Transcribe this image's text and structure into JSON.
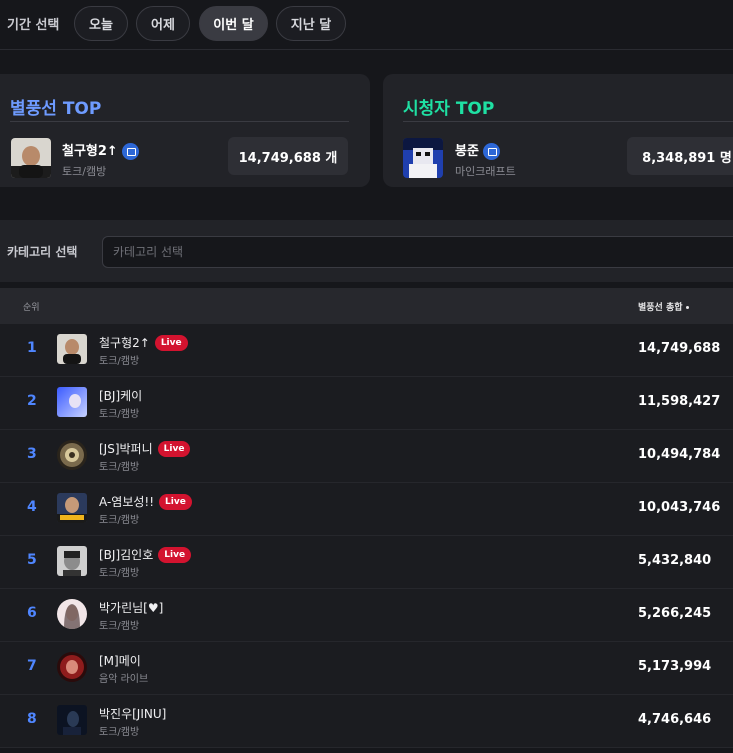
{
  "period": {
    "label": "기간 선택",
    "options": [
      {
        "label": "오늘"
      },
      {
        "label": "어제"
      },
      {
        "label": "이번 달",
        "active": true
      },
      {
        "label": "지난 달"
      }
    ]
  },
  "balloon_top": {
    "title": "별풍선 TOP",
    "title_color": "#6e9bff",
    "name": "철구형2↑",
    "category": "토크/캠방",
    "count": "14,749,688 개"
  },
  "viewer_top": {
    "title": "시청자 TOP",
    "title_color": "#1fe0a3",
    "name": "봉준",
    "category": "마인크래프트",
    "count": "8,348,891 명"
  },
  "category": {
    "label": "카테고리 선택",
    "placeholder": "카테고리 선택"
  },
  "table": {
    "header_rank": "순위",
    "header_total": "별풍선 총합",
    "live_label": "Live",
    "rows": [
      {
        "rank": "1",
        "name": "철구형2↑",
        "category": "토크/캠방",
        "value": "14,749,688",
        "live": true
      },
      {
        "rank": "2",
        "name": "[BJ]케이",
        "category": "토크/캠방",
        "value": "11,598,427",
        "live": false
      },
      {
        "rank": "3",
        "name": "[JS]박퍼니",
        "category": "토크/캠방",
        "value": "10,494,784",
        "live": true
      },
      {
        "rank": "4",
        "name": "A-염보성!!",
        "category": "토크/캠방",
        "value": "10,043,746",
        "live": true
      },
      {
        "rank": "5",
        "name": "[BJ]김인호",
        "category": "토크/캠방",
        "value": "5,432,840",
        "live": true
      },
      {
        "rank": "6",
        "name": "박가린님[♥]",
        "category": "토크/캠방",
        "value": "5,266,245",
        "live": false
      },
      {
        "rank": "7",
        "name": "[M]메이",
        "category": "음악 라이브",
        "value": "5,173,994",
        "live": false
      },
      {
        "rank": "8",
        "name": "박진우[JINU]",
        "category": "토크/캠방",
        "value": "4,746,646",
        "live": false
      }
    ]
  }
}
